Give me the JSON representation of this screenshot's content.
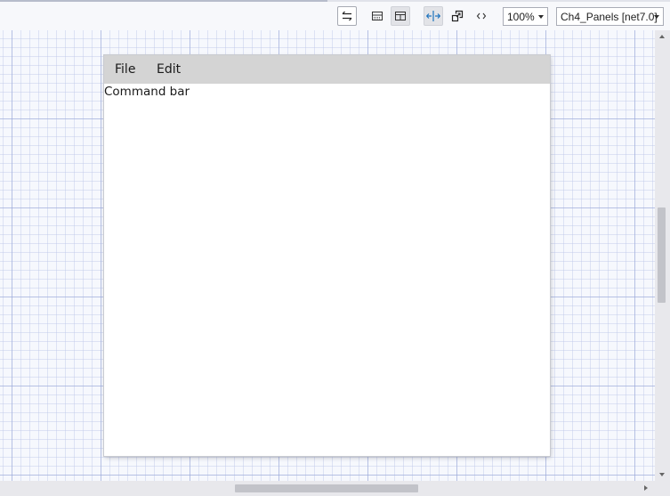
{
  "toolbar": {
    "buttons": [
      {
        "name": "swap-panes-icon",
        "state": "boxed"
      },
      {
        "name": "horizontal-split-icon",
        "state": "normal"
      },
      {
        "name": "vertical-split-icon",
        "state": "pressed"
      },
      {
        "name": "fit-width-icon",
        "state": "pressed"
      },
      {
        "name": "scale-icon",
        "state": "normal"
      },
      {
        "name": "code-view-icon",
        "state": "normal"
      }
    ],
    "zoom": "100%",
    "target": "Ch4_Panels [net7.0]"
  },
  "preview": {
    "menu": [
      "File",
      "Edit"
    ],
    "content_label": "Command bar"
  },
  "colors": {
    "menu_bar": "#d4d4d4",
    "canvas_bg": "#f6f8fd",
    "grid_major": "#96a5d7",
    "accent_icon": "#1e73be"
  },
  "scrollbars": {
    "vertical_position": 0.4,
    "horizontal_position": 0.45
  }
}
